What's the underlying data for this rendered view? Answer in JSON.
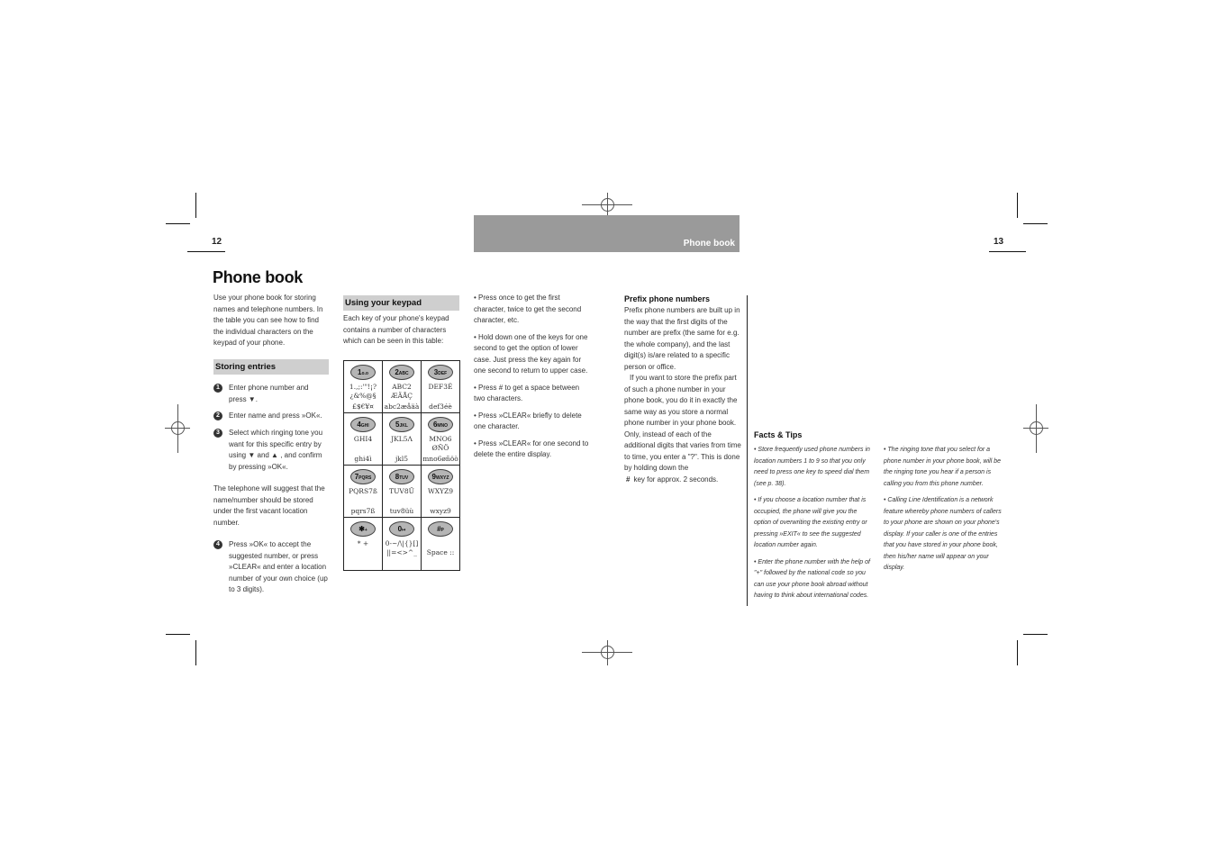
{
  "page_left": {
    "page_number": "12",
    "title": "Phone book",
    "intro": "Use your phone book for storing names and telephone numbers. In the table you can see how to find the individual characters on the keypad of your phone.",
    "section_storing": {
      "heading": "Storing entries",
      "steps": [
        {
          "num": "1",
          "text": "Enter phone number and press ▼."
        },
        {
          "num": "2",
          "text": "Enter name and press »OK«."
        },
        {
          "num": "3",
          "text": "Select which ringing tone you want for this specific entry by using ▼ and ▲ , and confirm by pressing »OK«."
        },
        {
          "num": "4",
          "text": "Press »OK« to accept the suggested number, or press »CLEAR« and enter a location number of your own choice (up to 3 digits)."
        }
      ],
      "note": "The telephone will suggest that the name/number should be stored under the first vacant location number."
    },
    "section_keypad": {
      "heading": "Using your keypad",
      "intro": "Each key of your phone's keypad contains a number of characters which can be seen in this table:",
      "keys": [
        {
          "key": "1",
          "key_sub": "o.o",
          "lines": [
            "1.,;:'\"!¡?",
            "¿&%@§",
            "£$€¥¤"
          ]
        },
        {
          "key": "2",
          "key_sub": "ABC",
          "lines": [
            "ABC2",
            "ÆÄÅÇ",
            "abc2æåäà"
          ]
        },
        {
          "key": "3",
          "key_sub": "DEF",
          "lines": [
            "DEF3É",
            "",
            "def3éè"
          ]
        },
        {
          "key": "4",
          "key_sub": "GHI",
          "lines": [
            "GHI4",
            "",
            "ghi4ì"
          ]
        },
        {
          "key": "5",
          "key_sub": "JKL",
          "lines": [
            "JKL5Λ",
            "",
            "jkl5"
          ]
        },
        {
          "key": "6",
          "key_sub": "MNO",
          "lines": [
            "MNO6",
            "ØÑÖ",
            "mno6øñöò"
          ]
        },
        {
          "key": "7",
          "key_sub": "PQRS",
          "lines": [
            "PQRS7ß",
            "",
            "pqrs7ß"
          ]
        },
        {
          "key": "8",
          "key_sub": "TUV",
          "lines": [
            "TUV8Ü",
            "",
            "tuv8üù"
          ]
        },
        {
          "key": "9",
          "key_sub": "WXYZ",
          "lines": [
            "WXYZ9",
            "",
            "wxyz9"
          ]
        },
        {
          "key": "✱",
          "key_sub": "+",
          "lines": [
            "* +",
            "",
            ""
          ]
        },
        {
          "key": "0",
          "key_sub": "↦",
          "lines": [
            "0-~/\\|{}[]",
            "||=<>^_",
            ""
          ]
        },
        {
          "key": "#",
          "key_sub": "P",
          "lines": [
            "",
            "Space ::",
            ""
          ]
        }
      ]
    }
  },
  "page_right": {
    "page_number": "13",
    "header": "Phone book",
    "keypad_tips": [
      "• Press once to get the first character, twice to get the second character, etc.",
      "• Hold down one of the keys for one second to get the option of lower case. Just press the key again for one second to return to upper case.",
      "• Press # to get a space between two characters.",
      "• Press »CLEAR« briefly to delete one character.",
      "• Press »CLEAR« for one second to delete the entire display."
    ],
    "prefix": {
      "heading": "Prefix phone numbers",
      "para1": "Prefix phone numbers are built up in the way that the first digits of the number are prefix (the same for e.g. the whole company), and the last digit(s) is/are related to a specific person or office.",
      "para2": "If you want to store the prefix part of such a phone number in your phone book, you do it in exactly the same way as you store a normal phone number in your phone book. Only, instead of each of the additional digits that varies from time to time, you enter a \"?\". This is done by holding down the",
      "para2_end": "key for approx. 2 seconds.",
      "hash_glyph": "#"
    },
    "facts": {
      "heading": "Facts & Tips",
      "col1": [
        "• Store frequently used phone numbers in location numbers 1 to 9 so that you only need to press one key to speed dial them (see p. 38).",
        "• If you choose a location number that is occupied, the phone will give you the option of overwriting the existing entry or pressing »EXIT« to see the suggested location number again.",
        "• Enter the phone number with the help of \"+\" followed by the national code so you can use your phone book abroad without having to think about international codes."
      ],
      "col2": [
        "• The ringing tone that you select for a phone number in your phone book, will be the ringing tone you hear if a person is calling you from this phone number.",
        "• Calling Line Identification is a network feature whereby phone numbers of callers to your phone are shown on your phone's display. If your caller is one of the entries that you have stored in your phone book, then his/her name will appear on your display."
      ]
    }
  },
  "colors": {
    "header_bar": "#9a9a9a",
    "section_bar": "#cfcfcf",
    "key_fill": "#b5b5b5"
  }
}
